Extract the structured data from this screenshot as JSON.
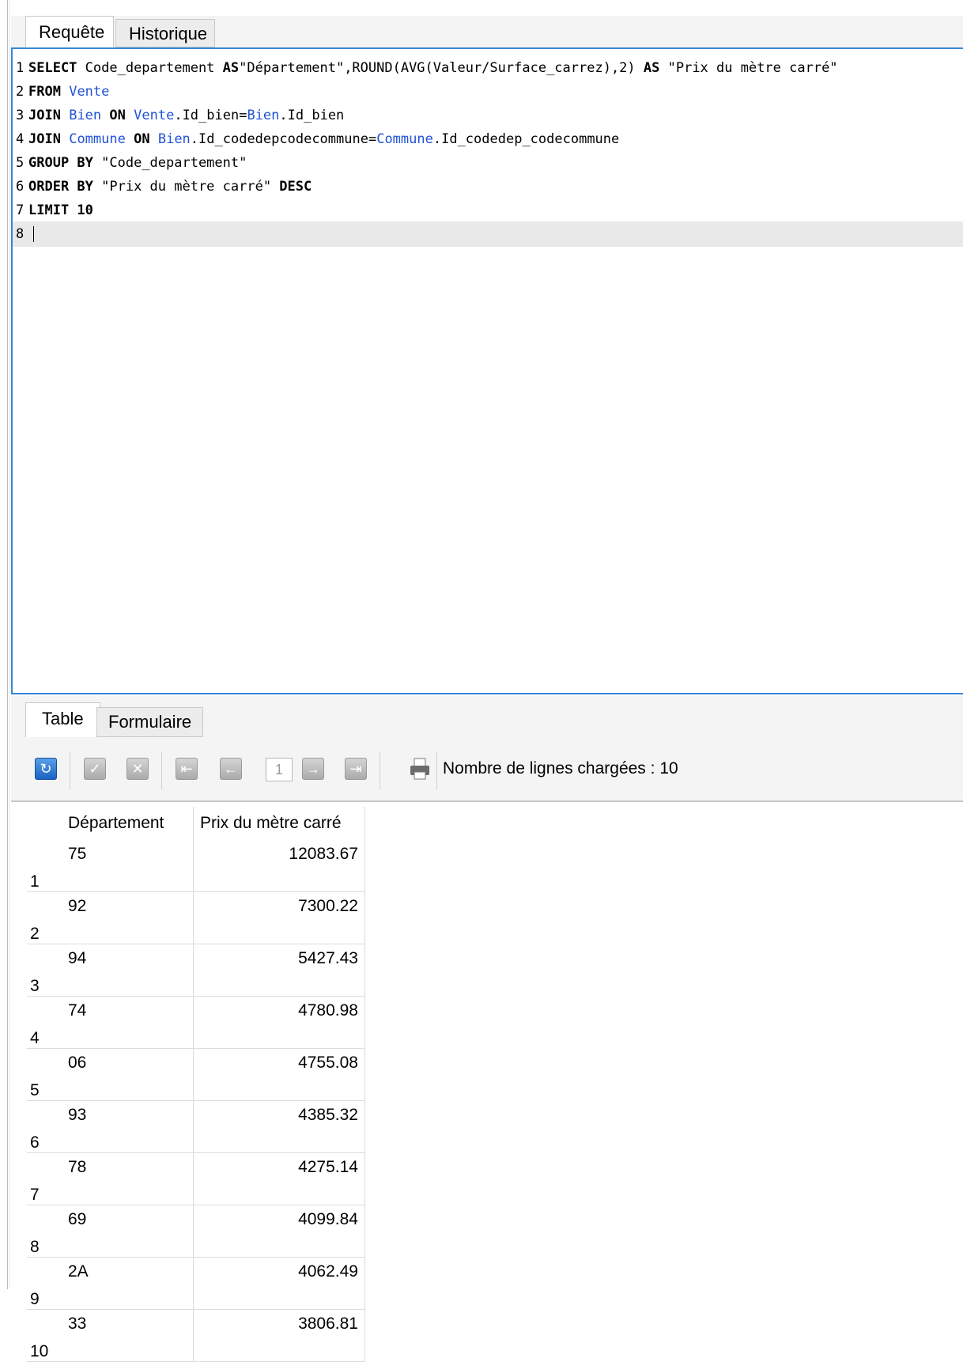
{
  "tabs_top": [
    {
      "label": "Requête",
      "active": true
    },
    {
      "label": "Historique",
      "active": false
    }
  ],
  "editor": {
    "lines": [
      {
        "num": "1",
        "parts": [
          {
            "t": "kw",
            "s": "SELECT"
          },
          {
            "t": "plain",
            "s": " Code_departement "
          },
          {
            "t": "kw",
            "s": "AS"
          },
          {
            "t": "plain",
            "s": "\"Département\",ROUND(AVG(Valeur/Surface_carrez),2) "
          },
          {
            "t": "kw",
            "s": "AS"
          },
          {
            "t": "plain",
            "s": " \"Prix du mètre carré\""
          }
        ]
      },
      {
        "num": "2",
        "parts": [
          {
            "t": "kw",
            "s": "FROM"
          },
          {
            "t": "plain",
            "s": " "
          },
          {
            "t": "tbl",
            "s": "Vente"
          }
        ]
      },
      {
        "num": "3",
        "parts": [
          {
            "t": "kw",
            "s": "JOIN"
          },
          {
            "t": "plain",
            "s": " "
          },
          {
            "t": "tbl",
            "s": "Bien"
          },
          {
            "t": "plain",
            "s": " "
          },
          {
            "t": "kw",
            "s": "ON"
          },
          {
            "t": "plain",
            "s": " "
          },
          {
            "t": "tbl",
            "s": "Vente"
          },
          {
            "t": "plain",
            "s": ".Id_bien="
          },
          {
            "t": "tbl",
            "s": "Bien"
          },
          {
            "t": "plain",
            "s": ".Id_bien"
          }
        ]
      },
      {
        "num": "4",
        "parts": [
          {
            "t": "kw",
            "s": "JOIN"
          },
          {
            "t": "plain",
            "s": " "
          },
          {
            "t": "tbl",
            "s": "Commune"
          },
          {
            "t": "plain",
            "s": " "
          },
          {
            "t": "kw",
            "s": "ON"
          },
          {
            "t": "plain",
            "s": " "
          },
          {
            "t": "tbl",
            "s": "Bien"
          },
          {
            "t": "plain",
            "s": ".Id_codedepcodecommune="
          },
          {
            "t": "tbl",
            "s": "Commune"
          },
          {
            "t": "plain",
            "s": ".Id_codedep_codecommune"
          }
        ]
      },
      {
        "num": "5",
        "parts": [
          {
            "t": "kw",
            "s": "GROUP BY"
          },
          {
            "t": "plain",
            "s": " \"Code_departement\""
          }
        ]
      },
      {
        "num": "6",
        "parts": [
          {
            "t": "kw",
            "s": "ORDER BY"
          },
          {
            "t": "plain",
            "s": " \"Prix du mètre carré\" "
          },
          {
            "t": "kw",
            "s": "DESC"
          }
        ]
      },
      {
        "num": "7",
        "parts": [
          {
            "t": "kw",
            "s": "LIMIT 10"
          }
        ]
      },
      {
        "num": "8",
        "parts": [],
        "current": true
      }
    ]
  },
  "tabs_bottom": [
    {
      "label": "Table",
      "active": true
    },
    {
      "label": "Formulaire",
      "active": false
    }
  ],
  "toolbar": {
    "refresh_icon": "refresh-icon",
    "page_number": "1",
    "row_count_label": "Nombre de lignes chargées : 10"
  },
  "results": {
    "columns": [
      "Département",
      "Prix du mètre carré"
    ],
    "rows": [
      [
        "75",
        "12083.67"
      ],
      [
        "92",
        "7300.22"
      ],
      [
        "94",
        "5427.43"
      ],
      [
        "74",
        "4780.98"
      ],
      [
        "06",
        "4755.08"
      ],
      [
        "93",
        "4385.32"
      ],
      [
        "78",
        "4275.14"
      ],
      [
        "69",
        "4099.84"
      ],
      [
        "2A",
        "4062.49"
      ],
      [
        "33",
        "3806.81"
      ]
    ]
  },
  "colors": {
    "keyword": "#000000",
    "table_name": "#2152d6",
    "editor_border": "#3a86d6"
  }
}
